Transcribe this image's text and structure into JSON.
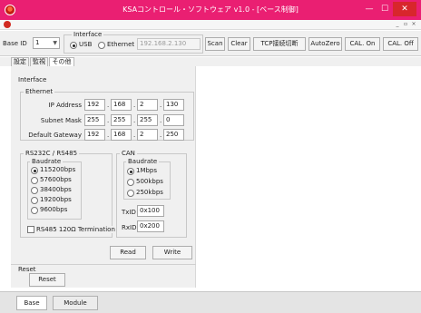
{
  "window": {
    "title": "KSAコントロール・ソフトウェア v1.0 - [ベース制御]",
    "minimize_glyph": "—",
    "maximize_glyph": "☐",
    "close_glyph": "✕",
    "mdi_glyphs": [
      "_",
      "▫",
      "×"
    ]
  },
  "toolbar": {
    "base_id_label": "Base ID",
    "base_id_value": "1",
    "interface_group_label": "Interface",
    "usb_label": "USB",
    "ethernet_label": "Ethernet",
    "ip_value": "192.168.2.130",
    "interface_selected": "USB",
    "buttons": {
      "scan": "Scan",
      "clear": "Clear",
      "tcp_switch": "TCP接続切断",
      "autozero": "AutoZero",
      "cal_on": "CAL. On",
      "cal_off": "CAL. Off"
    }
  },
  "tabs": {
    "settings": "設定",
    "monitor": "監視",
    "other": "その他",
    "active": "other"
  },
  "interface": {
    "section_label": "Interface",
    "ethernet_label": "Ethernet",
    "ip_address_label": "IP Address",
    "ip_address": [
      "192",
      "168",
      "2",
      "130"
    ],
    "subnet_mask_label": "Subnet Mask",
    "subnet_mask": [
      "255",
      "255",
      "255",
      "0"
    ],
    "gateway_label": "Default Gateway",
    "gateway": [
      "192",
      "168",
      "2",
      "250"
    ],
    "dot": "."
  },
  "rs232c": {
    "group_label": "RS232C / RS485",
    "baudrate_label": "Baudrate",
    "options": [
      "115200bps",
      "57600bps",
      "38400bps",
      "19200bps",
      "9600bps"
    ],
    "selected": "115200bps",
    "termination_label": "RS485 120Ω Termination",
    "termination_checked": false
  },
  "can": {
    "group_label": "CAN",
    "baudrate_label": "Baudrate",
    "options": [
      "1Mbps",
      "500kbps",
      "250kbps"
    ],
    "selected": "1Mbps",
    "txid_label": "TxID",
    "txid_value": "0x100",
    "rxid_label": "RxID",
    "rxid_value": "0x200"
  },
  "actions": {
    "read": "Read",
    "write": "Write"
  },
  "reset": {
    "section_label": "Reset",
    "button_label": "Reset"
  },
  "bottom_tabs": {
    "base": "Base",
    "module": "Module",
    "active": "base"
  }
}
